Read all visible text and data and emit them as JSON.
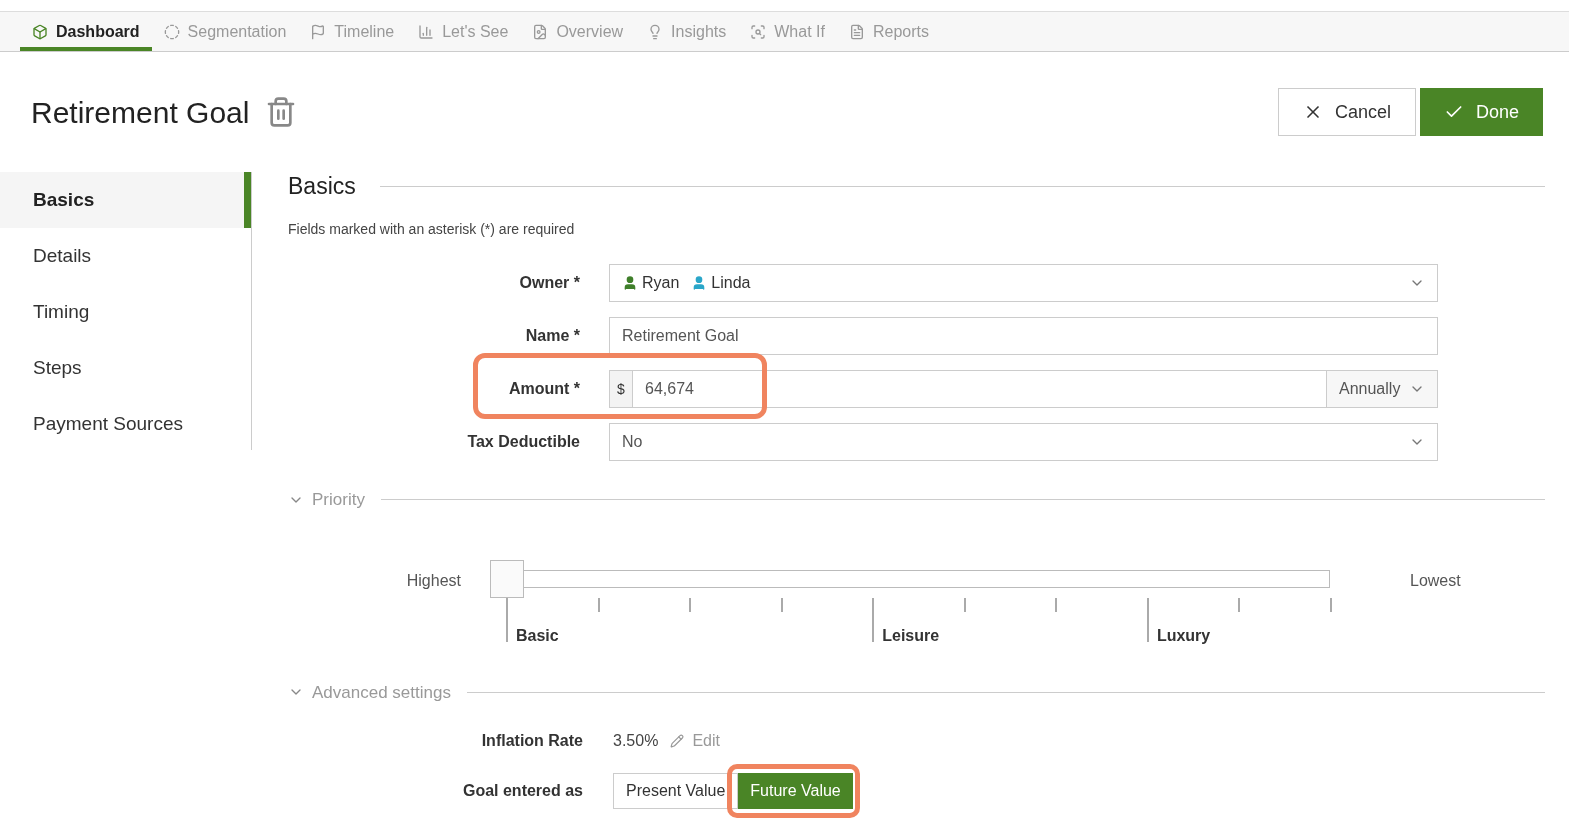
{
  "tabs": [
    {
      "label": "Dashboard",
      "selected": true
    },
    {
      "label": "Segmentation",
      "selected": false
    },
    {
      "label": "Timeline",
      "selected": false
    },
    {
      "label": "Let's See",
      "selected": false
    },
    {
      "label": "Overview",
      "selected": false
    },
    {
      "label": "Insights",
      "selected": false
    },
    {
      "label": "What If",
      "selected": false
    },
    {
      "label": "Reports",
      "selected": false
    }
  ],
  "title": "Retirement Goal",
  "actions": {
    "cancel": "Cancel",
    "done": "Done"
  },
  "sidebar": {
    "items": [
      {
        "label": "Basics",
        "selected": true
      },
      {
        "label": "Details",
        "selected": false
      },
      {
        "label": "Timing",
        "selected": false
      },
      {
        "label": "Steps",
        "selected": false
      },
      {
        "label": "Payment Sources",
        "selected": false
      }
    ]
  },
  "section": {
    "title": "Basics",
    "note": "Fields marked with an asterisk (*) are required"
  },
  "owner": {
    "label": "Owner *",
    "people": [
      {
        "name": "Ryan",
        "color": "#3f7f2a"
      },
      {
        "name": "Linda",
        "color": "#2aa6c9"
      }
    ]
  },
  "name": {
    "label": "Name *",
    "value": "Retirement Goal"
  },
  "amount": {
    "label": "Amount *",
    "prefix": "$",
    "value": "64,674",
    "frequency": "Annually",
    "highlighted": true
  },
  "tax": {
    "label": "Tax Deductible",
    "value": "No"
  },
  "priority": {
    "title": "Priority",
    "expanded": true,
    "low_label": "Highest",
    "high_label": "Lowest",
    "level": 0,
    "markers": [
      {
        "label": "Basic"
      },
      {
        "label": "Leisure"
      },
      {
        "label": "Luxury"
      }
    ]
  },
  "advanced": {
    "title": "Advanced settings",
    "expanded": true,
    "inflation_label": "Inflation Rate",
    "inflation_value": "3.50%",
    "edit": "Edit",
    "entered_label": "Goal entered as",
    "options": [
      {
        "label": "Present Value",
        "selected": false,
        "highlighted": false
      },
      {
        "label": "Future Value",
        "selected": true,
        "highlighted": true
      }
    ]
  }
}
